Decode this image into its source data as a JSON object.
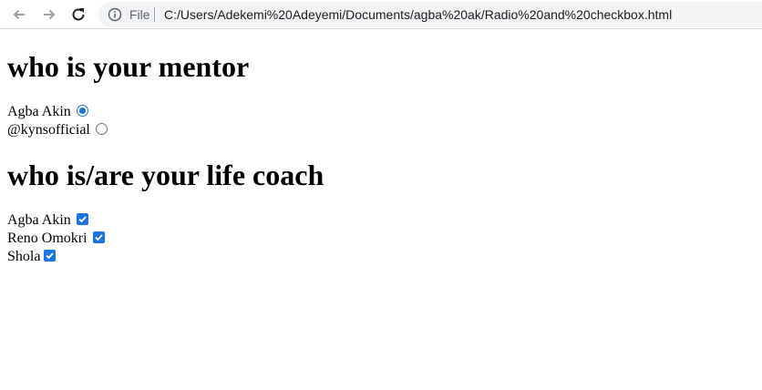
{
  "browser": {
    "file_label": "File",
    "url": "C:/Users/Adekemi%20Adeyemi/Documents/agba%20ak/Radio%20and%20checkbox.html",
    "icons": {
      "back": "arrow-left-icon",
      "forward": "arrow-right-icon",
      "reload": "reload-icon",
      "info": "info-icon"
    }
  },
  "mentor_section": {
    "heading": "who is your mentor",
    "options": [
      {
        "label": "Agba Akin",
        "checked": true
      },
      {
        "label": "@kynsofficial",
        "checked": false
      }
    ]
  },
  "coach_section": {
    "heading": "who is/are your life coach",
    "options": [
      {
        "label": "Agba Akin",
        "checked": true
      },
      {
        "label": "Reno Omokri",
        "checked": true
      },
      {
        "label": "Shola",
        "checked": true
      }
    ]
  },
  "colors": {
    "accent": "#1a73e8",
    "omnibox_bg": "#f1f3f4"
  }
}
